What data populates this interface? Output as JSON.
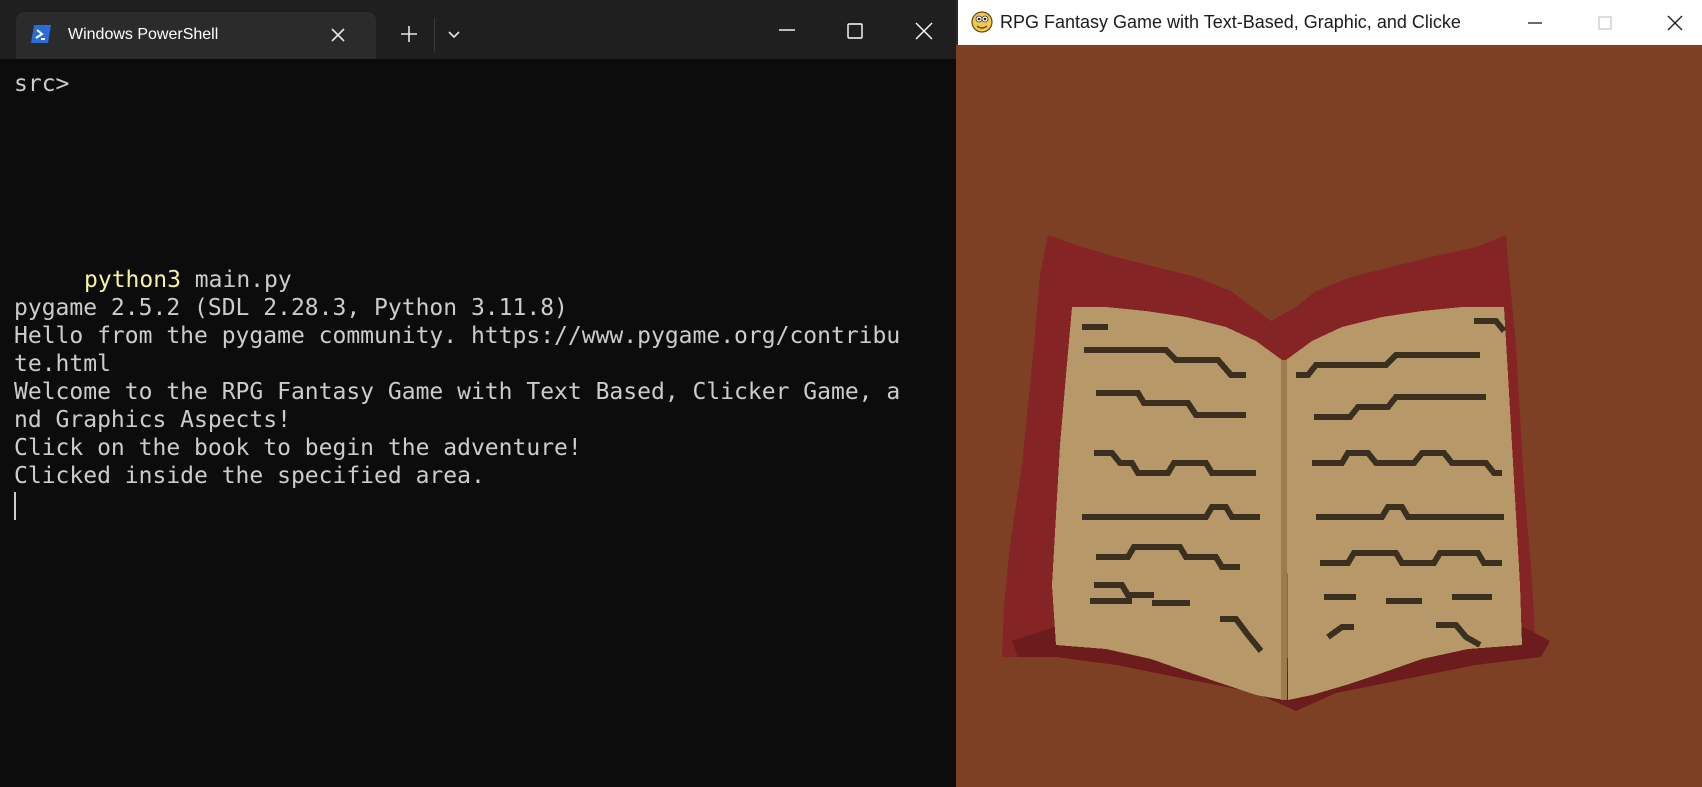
{
  "terminal": {
    "tab_title": "Windows PowerShell",
    "icons": {
      "tab": "powershell-icon",
      "close_tab": "close-icon",
      "new_tab": "plus-icon",
      "dropdown": "chevron-down-icon",
      "minimize": "minimize-icon",
      "maximize": "maximize-icon",
      "close": "close-icon"
    },
    "prompt": "src>",
    "command_keyword": "python3",
    "command_args": " main.py",
    "output": [
      "pygame 2.5.2 (SDL 2.28.3, Python 3.11.8)",
      "Hello from the pygame community. https://www.pygame.org/contribu",
      "te.html",
      "Welcome to the RPG Fantasy Game with Text Based, Clicker Game, a",
      "nd Graphics Aspects!",
      "Click on the book to begin the adventure!",
      "Clicked inside the specified area."
    ],
    "colors": {
      "background": "#0c0c0c",
      "text": "#cccccc",
      "command": "#f9f1a5"
    }
  },
  "game_window": {
    "title": "RPG Fantasy Game with Text-Based, Graphic, and Clicker Ele...",
    "icons": {
      "app": "pygame-snake-icon",
      "minimize": "minimize-icon",
      "maximize": "maximize-icon",
      "close": "close-icon"
    },
    "scene": "open-book",
    "colors": {
      "background": "#7e4024",
      "book_cover": "#842424",
      "pages": "#b79868",
      "text_lines": "#3b2f20"
    }
  }
}
